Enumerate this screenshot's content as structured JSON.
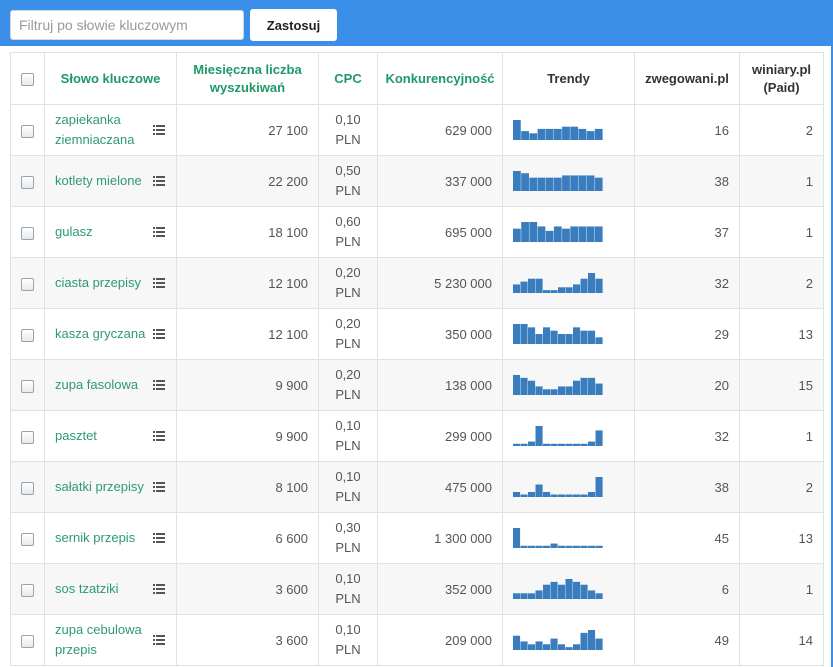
{
  "filter": {
    "placeholder": "Filtruj po słowie kluczowym",
    "value": "",
    "apply_label": "Zastosuj"
  },
  "colors": {
    "topbar": "#3c8fe8",
    "keyword_link": "#2e9a72",
    "header_accent": "#1f9968",
    "trend_bar": "#3a7dbf"
  },
  "table": {
    "headers": {
      "keyword": "Słowo kluczowe",
      "volume_line1": "Miesięczna liczba",
      "volume_line2": "wyszukiwań",
      "cpc": "CPC",
      "competition": "Konkurencyjność",
      "trends": "Trendy",
      "site1": "zwegowani.pl",
      "site2_line1": "winiary.pl",
      "site2_line2": "(Paid)"
    },
    "rows": [
      {
        "keyword": "zapiekanka ziemniaczana",
        "volume": "27 100",
        "cpc_value": "0,10",
        "cpc_unit": "PLN",
        "competition": "629 000",
        "trend": [
          9,
          4,
          3,
          5,
          5,
          5,
          6,
          6,
          5,
          4,
          5
        ],
        "site1": "16",
        "site2": "2"
      },
      {
        "keyword": "kotlety mielone",
        "volume": "22 200",
        "cpc_value": "0,50",
        "cpc_unit": "PLN",
        "competition": "337 000",
        "trend": [
          9,
          8,
          6,
          6,
          6,
          6,
          7,
          7,
          7,
          7,
          6
        ],
        "site1": "38",
        "site2": "1"
      },
      {
        "keyword": "gulasz",
        "volume": "18 100",
        "cpc_value": "0,60",
        "cpc_unit": "PLN",
        "competition": "695 000",
        "trend": [
          6,
          9,
          9,
          7,
          5,
          7,
          6,
          7,
          7,
          7,
          7
        ],
        "site1": "37",
        "site2": "1"
      },
      {
        "keyword": "ciasta przepisy",
        "volume": "12 100",
        "cpc_value": "0,20",
        "cpc_unit": "PLN",
        "competition": "5 230 000",
        "trend": [
          3,
          4,
          5,
          5,
          1,
          1,
          2,
          2,
          3,
          5,
          7,
          5
        ],
        "site1": "32",
        "site2": "2"
      },
      {
        "keyword": "kasza gryczana",
        "volume": "12 100",
        "cpc_value": "0,20",
        "cpc_unit": "PLN",
        "competition": "350 000",
        "trend": [
          6,
          6,
          5,
          3,
          5,
          4,
          3,
          3,
          5,
          4,
          4,
          2
        ],
        "site1": "29",
        "site2": "13"
      },
      {
        "keyword": "zupa fasolowa",
        "volume": "9 900",
        "cpc_value": "0,20",
        "cpc_unit": "PLN",
        "competition": "138 000",
        "trend": [
          7,
          6,
          5,
          3,
          2,
          2,
          3,
          3,
          5,
          6,
          6,
          4
        ],
        "site1": "20",
        "site2": "15"
      },
      {
        "keyword": "pasztet",
        "volume": "9 900",
        "cpc_value": "0,10",
        "cpc_unit": "PLN",
        "competition": "299 000",
        "trend": [
          1,
          1,
          2,
          9,
          1,
          1,
          1,
          1,
          1,
          1,
          2,
          7
        ],
        "site1": "32",
        "site2": "1"
      },
      {
        "keyword": "sałatki przepisy",
        "volume": "8 100",
        "cpc_value": "0,10",
        "cpc_unit": "PLN",
        "competition": "475 000",
        "trend": [
          2,
          1,
          2,
          5,
          2,
          1,
          1,
          1,
          1,
          1,
          2,
          8
        ],
        "site1": "38",
        "site2": "2"
      },
      {
        "keyword": "sernik przepis",
        "volume": "6 600",
        "cpc_value": "0,30",
        "cpc_unit": "PLN",
        "competition": "1 300 000",
        "trend": [
          9,
          1,
          1,
          1,
          1,
          2,
          1,
          1,
          1,
          1,
          1,
          1
        ],
        "site1": "45",
        "site2": "13"
      },
      {
        "keyword": "sos tzatziki",
        "volume": "3 600",
        "cpc_value": "0,10",
        "cpc_unit": "PLN",
        "competition": "352 000",
        "trend": [
          2,
          2,
          2,
          3,
          5,
          6,
          5,
          7,
          6,
          5,
          3,
          2
        ],
        "site1": "6",
        "site2": "1"
      },
      {
        "keyword": "zupa cebulowa przepis",
        "volume": "3 600",
        "cpc_value": "0,10",
        "cpc_unit": "PLN",
        "competition": "209 000",
        "trend": [
          5,
          3,
          2,
          3,
          2,
          4,
          2,
          1,
          2,
          6,
          7,
          4
        ],
        "site1": "49",
        "site2": "14"
      }
    ]
  }
}
